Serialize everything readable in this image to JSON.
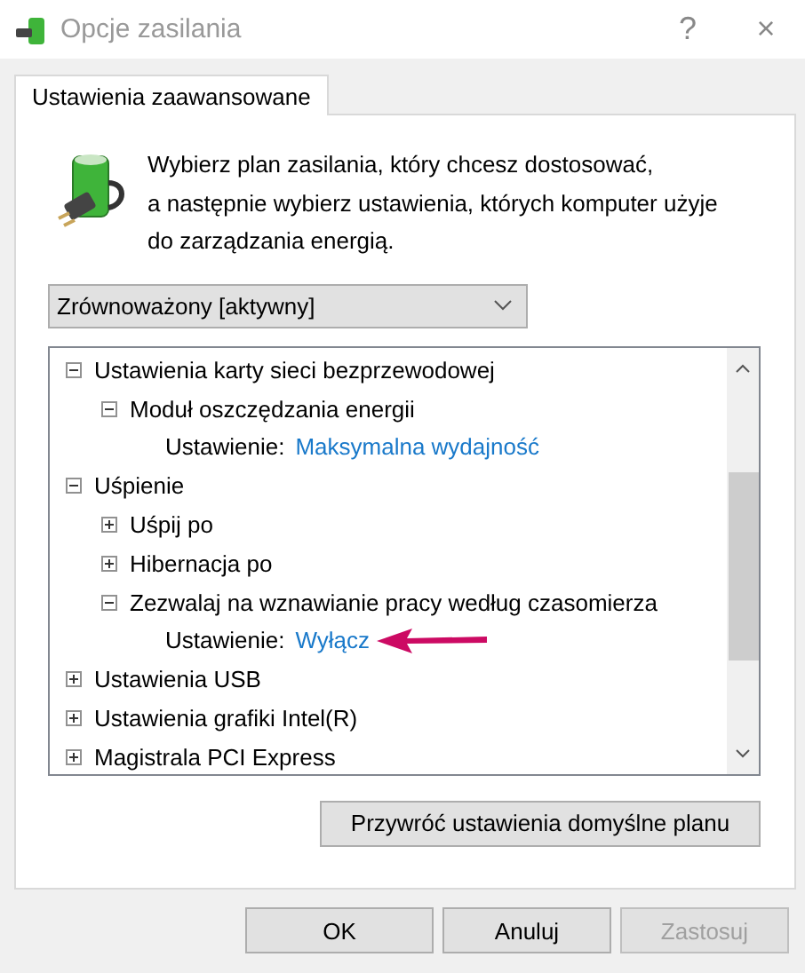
{
  "window": {
    "title": "Opcje zasilania",
    "help": "?",
    "close": "×"
  },
  "tabs": [
    {
      "label": "Ustawienia zaawansowane",
      "selected": true
    }
  ],
  "intro": "Wybierz plan zasilania, który chcesz dostosować,\na następnie wybierz ustawienia, których komputer użyje\ndo zarządzania energią.",
  "plan_select": {
    "value": "Zrównoważony [aktywny]"
  },
  "tree": [
    {
      "kind": "group",
      "label": "Ustawienia karty sieci bezprzewodowej",
      "expanded": true,
      "children": [
        {
          "kind": "group",
          "label": "Moduł oszczędzania energii",
          "expanded": true,
          "children": [
            {
              "kind": "setting",
              "label": "Ustawienie:",
              "value": "Maksymalna wydajność",
              "pointed": false
            }
          ]
        }
      ]
    },
    {
      "kind": "group",
      "label": "Uśpienie",
      "expanded": true,
      "children": [
        {
          "kind": "group",
          "label": "Uśpij po",
          "expanded": false
        },
        {
          "kind": "group",
          "label": "Hibernacja po",
          "expanded": false
        },
        {
          "kind": "group",
          "label": "Zezwalaj na wznawianie pracy według czasomierza",
          "expanded": true,
          "children": [
            {
              "kind": "setting",
              "label": "Ustawienie:",
              "value": "Wyłącz",
              "pointed": true
            }
          ]
        }
      ]
    },
    {
      "kind": "group",
      "label": "Ustawienia USB",
      "expanded": false
    },
    {
      "kind": "group",
      "label": "Ustawienia grafiki Intel(R)",
      "expanded": false
    },
    {
      "kind": "group",
      "label": "Magistrala PCI Express",
      "expanded": false
    }
  ],
  "restore_button": "Przywróć ustawienia domyślne planu",
  "buttons": [
    {
      "label": "OK",
      "disabled": false
    },
    {
      "label": "Anuluj",
      "disabled": false
    },
    {
      "label": "Zastosuj",
      "disabled": true
    }
  ]
}
